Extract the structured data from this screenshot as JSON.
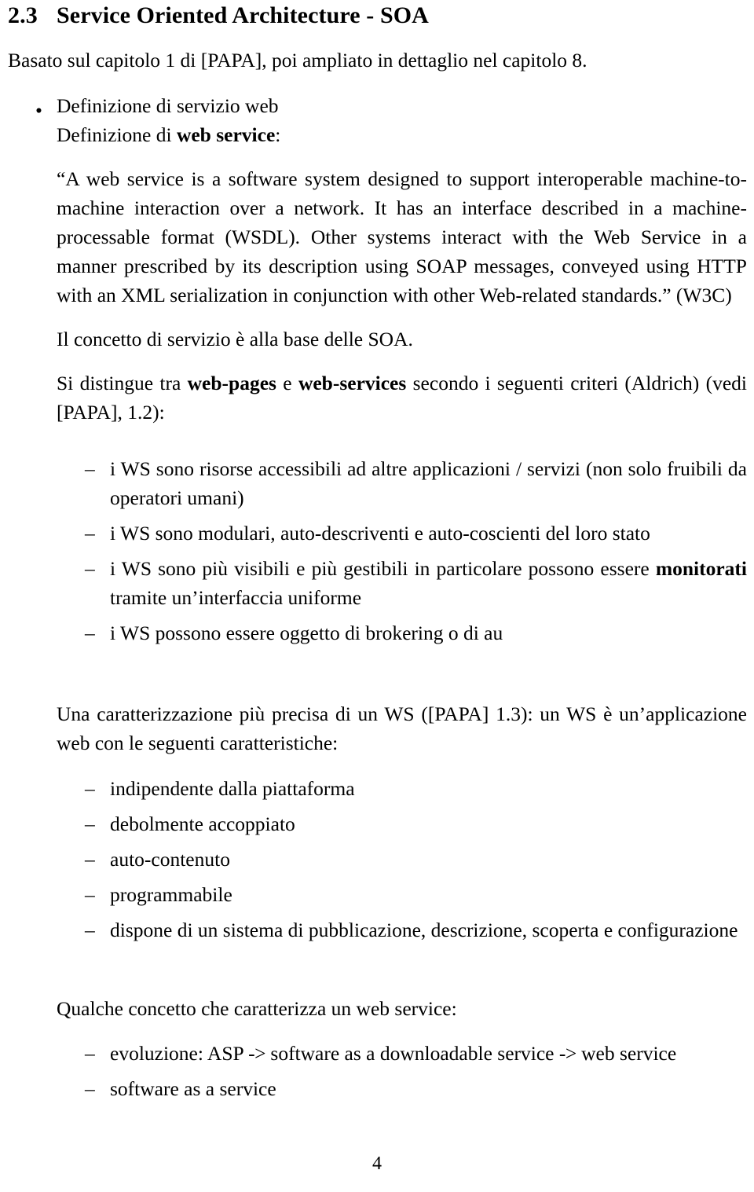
{
  "document": {
    "section": {
      "number": "2.3",
      "title": "Service Oriented Architecture - SOA"
    },
    "subtitle": "Basato sul capitolo 1 di [PAPA], poi ampliato in dettaglio nel capitolo 8.",
    "bullet": {
      "marker": "•",
      "line1": "Definizione di servizio web",
      "line2_prefix": "Definizione di ",
      "line2_bold": "web service",
      "line2_suffix": ":",
      "quote": "“A web service is a software system designed to support interoperable machine-to-machine interaction over a network. It has an interface described in a machine-processable format (WSDL). Other systems interact with the Web Service in a manner prescribed by its description using SOAP messages, conveyed using HTTP with an XML serialization in conjunction with other Web-related standards.” (W3C)",
      "para_concetto": "Il concetto di servizio è alla base delle SOA.",
      "para_distingue_part1": "Si distingue tra ",
      "para_distingue_bold1": "web-pages",
      "para_distingue_part2": " e ",
      "para_distingue_bold2": "web-services",
      "para_distingue_part3": " secondo i seguenti criteri (Aldrich) (vedi [PAPA], 1.2):"
    },
    "criteria_list": {
      "dash": "–",
      "items": [
        "i WS sono risorse accessibili ad altre applicazioni / servizi (non solo fruibili da operatori umani)",
        "i WS sono modulari, auto-descriventi e auto-coscienti del loro stato",
        "i WS possono essere oggetto di brokering o di au"
      ],
      "item_monitorati": {
        "prefix": "i WS sono più visibili e più gestibili in particolare possono essere ",
        "bold": "monitorati",
        "suffix": " tramite un’interfaccia uniforme"
      }
    },
    "para_caratterizzazione": "Una caratterizzazione più precisa di un WS ([PAPA] 1.3): un WS è un’applicazione web con le seguenti caratteristiche:",
    "characteristics_list": {
      "dash": "–",
      "items": [
        "indipendente dalla piattaforma",
        "debolmente accoppiato",
        "auto-contenuto",
        "programmabile",
        "dispone di un sistema di pubblicazione, descrizione, scoperta e configurazione"
      ]
    },
    "para_qualche": "Qualche concetto che caratterizza un web service:",
    "concepts_list": {
      "dash": "–",
      "item_evoluzione_prefix": "evoluzione:  ASP ",
      "item_evoluzione_arrow1": "->",
      "item_evoluzione_mid": " software as a downloadable service ",
      "item_evoluzione_arrow2": "->",
      "item_evoluzione_suffix": " web service",
      "item_saas": "software as a service"
    },
    "page_number": "4"
  }
}
